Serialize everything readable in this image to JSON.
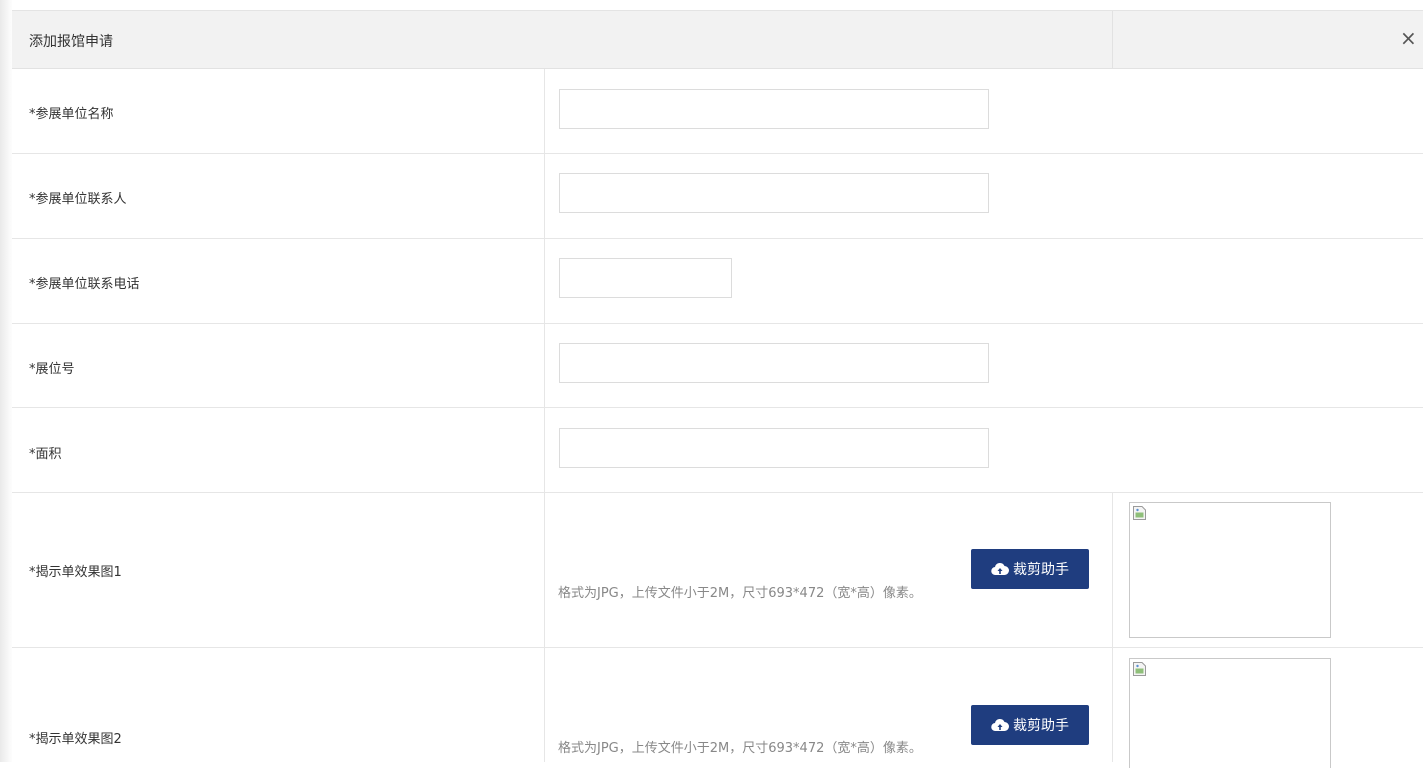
{
  "dialog": {
    "title": "添加报馆申请",
    "close_glyph": "×"
  },
  "form": {
    "fields": [
      {
        "label": "*参展单位名称",
        "value": ""
      },
      {
        "label": "*参展单位联系人",
        "value": ""
      },
      {
        "label": "*参展单位联系电话",
        "value": ""
      },
      {
        "label": "*展位号",
        "value": ""
      },
      {
        "label": "*面积",
        "value": ""
      }
    ],
    "uploads": [
      {
        "label": "*揭示单效果图1",
        "hint": "格式为JPG，上传文件小于2M，尺寸693*472（宽*高）像素。",
        "button_label": "裁剪助手"
      },
      {
        "label": "*揭示单效果图2",
        "hint": "格式为JPG，上传文件小于2M，尺寸693*472（宽*高）像素。",
        "button_label": "裁剪助手"
      }
    ]
  },
  "colors": {
    "button_bg": "#1f3d7f",
    "header_bg": "#f2f2f2",
    "hint_text": "#888888"
  },
  "icons": {
    "upload": "cloud-upload-icon",
    "close": "close-icon",
    "broken_image": "broken-image-icon"
  }
}
